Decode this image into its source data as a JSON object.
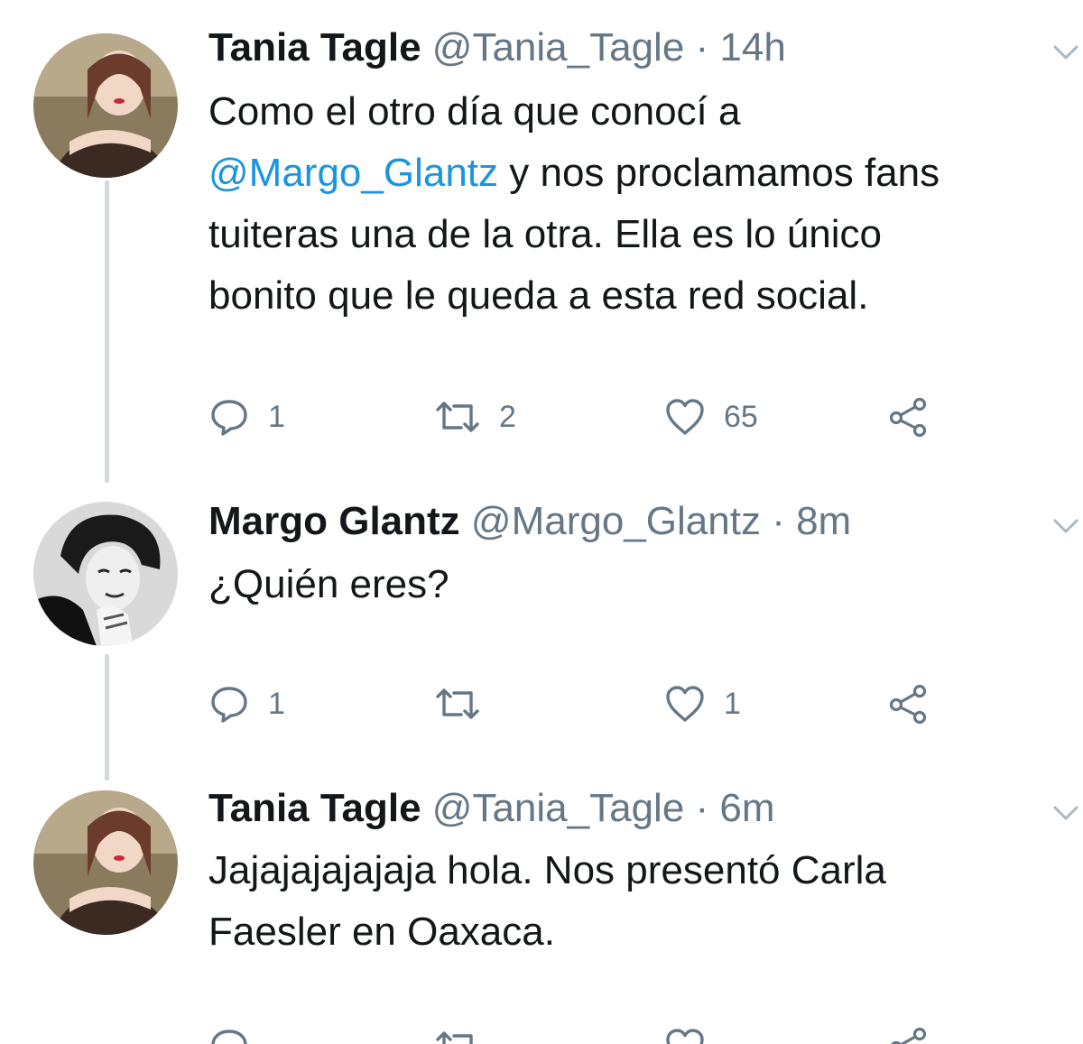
{
  "tweets": [
    {
      "name": "Tania Tagle",
      "handle": "@Tania_Tagle",
      "separator": "·",
      "time": "14h",
      "text_lines": [
        "Como el otro día que conocí a",
        {
          "mention": "@Margo_Glantz",
          "rest": " y nos proclamamos fans"
        },
        "tuiteras una de la otra. Ella es lo único",
        "bonito que le queda a esta red social."
      ],
      "reply_count": "1",
      "retweet_count": "2",
      "like_count": "65"
    },
    {
      "name": "Margo Glantz",
      "handle": "@Margo_Glantz",
      "separator": "·",
      "time": "8m",
      "text_lines": [
        "¿Quién eres?"
      ],
      "reply_count": "1",
      "retweet_count": "",
      "like_count": "1"
    },
    {
      "name": "Tania Tagle",
      "handle": "@Tania_Tagle",
      "separator": "·",
      "time": "6m",
      "text_lines": [
        "Jajajajajajaja hola. Nos presentó Carla",
        "Faesler en Oaxaca."
      ]
    }
  ],
  "icons": {
    "reply": "reply-icon",
    "retweet": "retweet-icon",
    "like": "heart-icon",
    "share": "share-icon",
    "menu": "chevron-down-icon"
  },
  "colors": {
    "link": "#1b95e0",
    "secondary_text": "#657786",
    "thread_line": "#cfd9de"
  }
}
